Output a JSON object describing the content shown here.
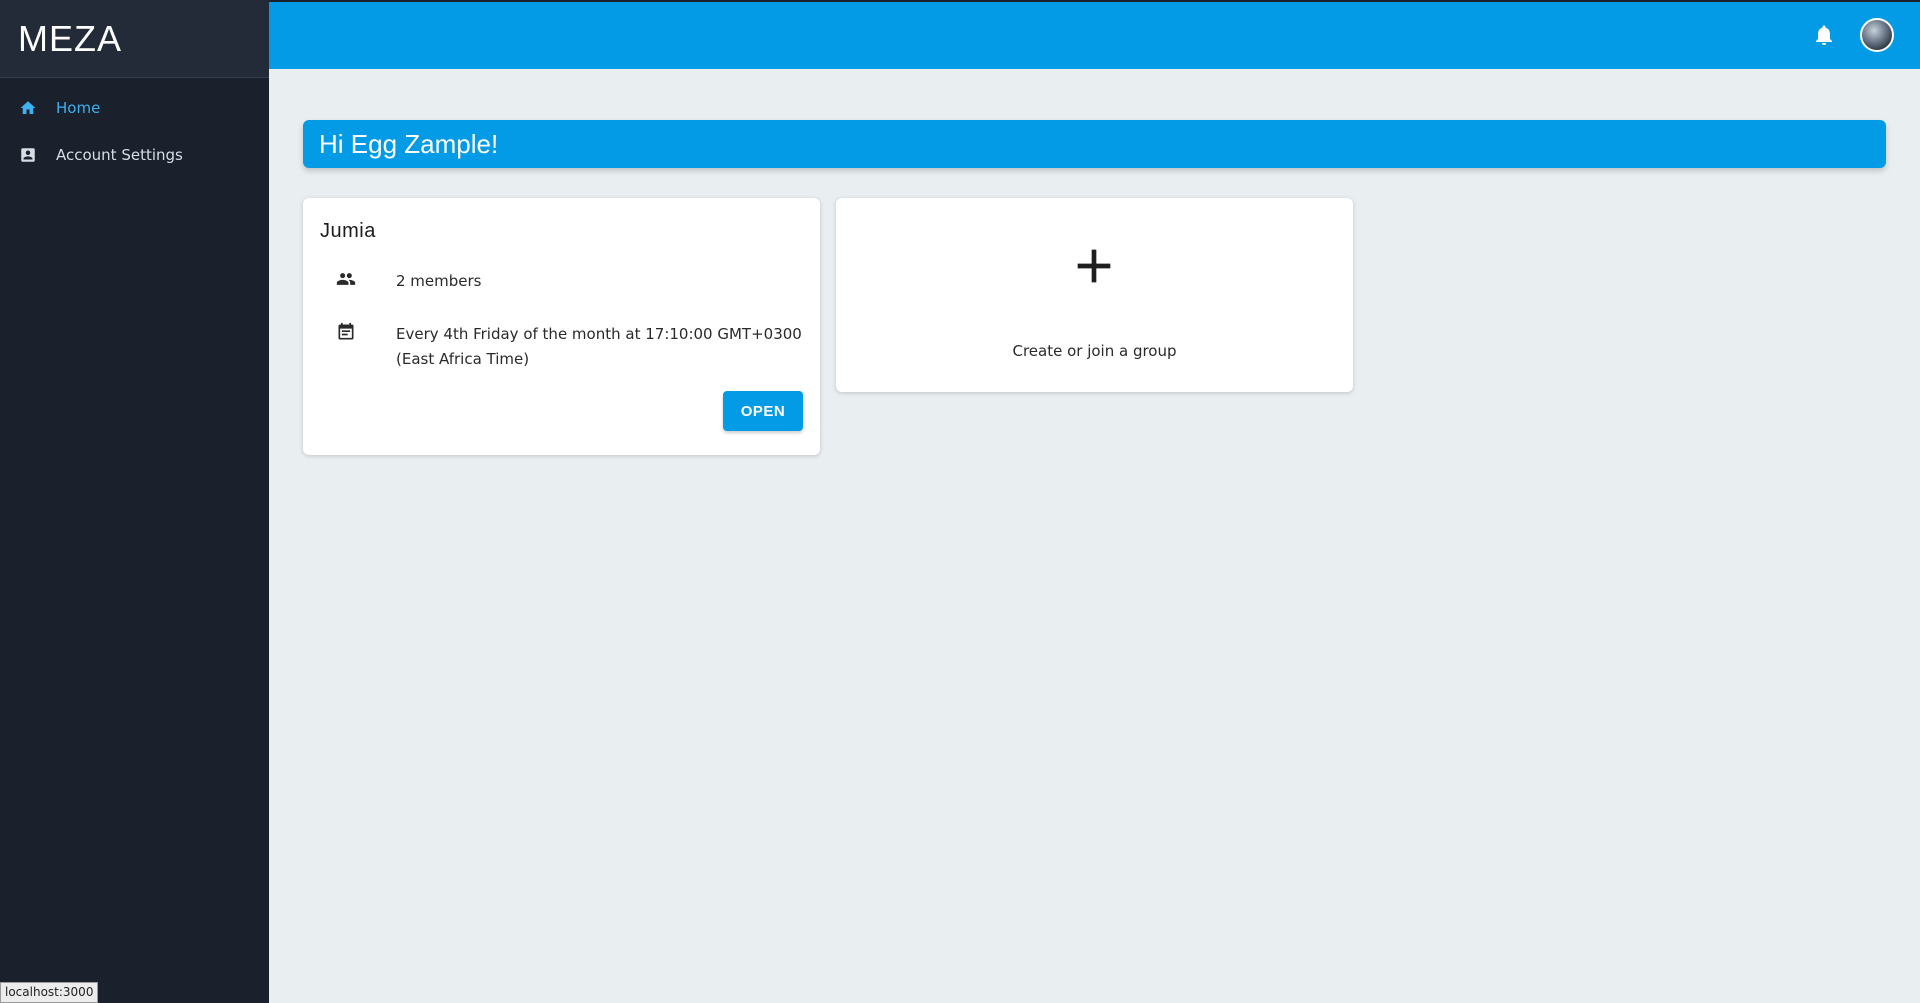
{
  "app": {
    "brand": "MEZA"
  },
  "sidebar": {
    "items": [
      {
        "label": "Home",
        "icon": "home-icon",
        "active": true
      },
      {
        "label": "Account Settings",
        "icon": "account-box-icon",
        "active": false
      }
    ]
  },
  "header": {
    "bell_icon": "bell-icon",
    "avatar": "user-avatar"
  },
  "greeting": "Hi Egg Zample!",
  "group_card": {
    "title": "Jumia",
    "members": "2 members",
    "schedule": "Every 4th Friday of the month at 17:10:00 GMT+0300 (East Africa Time)",
    "open_label": "OPEN"
  },
  "create_card": {
    "label": "Create or join a group"
  },
  "status_bar": {
    "url": "localhost:3000"
  },
  "colors": {
    "primary": "#039be5",
    "sidebar_bg": "#1a202c",
    "page_bg": "#e9eef1",
    "active_nav": "#3fb0f0"
  }
}
